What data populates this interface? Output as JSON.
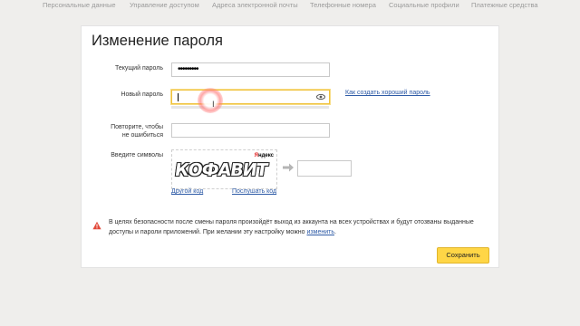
{
  "nav": {
    "items": [
      "Персональные данные",
      "Управление доступом",
      "Адреса электронной почты",
      "Телефонные номера",
      "Социальные профили",
      "Платежные средства"
    ]
  },
  "page": {
    "title": "Изменение пароля"
  },
  "form": {
    "current_password_label": "Текущий пароль",
    "current_password_value": "•••••••••",
    "new_password_label": "Новый пароль",
    "new_password_value": "",
    "good_password_link": "Как создать хороший пароль",
    "repeat_label_line1": "Повторите, чтобы",
    "repeat_label_line2": "не ошибиться",
    "captcha_label": "Введите символы",
    "captcha_text": "КОФАВИТ",
    "captcha_brand_y": "Я",
    "captcha_brand_rest": "ндекс",
    "other_code_link": "Другой код",
    "listen_code_link": "Послушать код",
    "captcha_input_value": ""
  },
  "warning": {
    "text": "В целях безопасности после смены пароля произойдёт выход из аккаунта на всех устройствах и будут отозваны выданные доступы и пароли приложений. При желании эту настройку можно ",
    "link": "изменить",
    "end": ".",
    "icon_color": "#e24a3b"
  },
  "actions": {
    "save_label": "Сохранить",
    "accent_color": "#ffd646"
  },
  "icons": {
    "eye": "eye-icon",
    "arrow": "arrow-right-icon",
    "warning": "warning-icon"
  }
}
